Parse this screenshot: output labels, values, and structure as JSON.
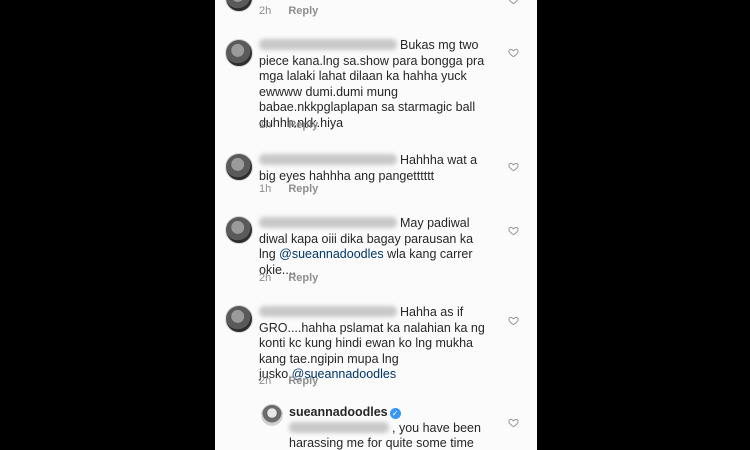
{
  "comments": [
    {
      "text": "",
      "time": "2h",
      "reply": "Reply"
    },
    {
      "text": "Bukas mg two piece kana.lng sa.show para bongga pra mga lalaki lahat dilaan ka hahha yuck ewwww dumi.dumi mung babae.nkkpglaplapan sa starmagic ball duhhh.nkk.hiya",
      "time": "1h",
      "reply": "Reply"
    },
    {
      "text": "Hahhha wat a big eyes hahhha ang pangetttttt",
      "time": "1h",
      "reply": "Reply"
    },
    {
      "text_before": "May padiwal diwal kapa oiii dika bagay parausan ka lng ",
      "mention": "@sueannadoodles",
      "text_after": " wla kang carrer okie....",
      "time": "2h",
      "reply": "Reply"
    },
    {
      "text": "Hahha as if GRO....hahha pslamat ka nalahian ka ng konti kc kung hindi ewan ko lng mukha kang tae.ngipin mupa lng jusko.",
      "mention": "@sueannadoodles",
      "time": "2h",
      "reply": "Reply"
    }
  ],
  "reply_comment": {
    "username": "sueannadoodles",
    "verified_mark": "✓",
    "text": ", you have been harassing me for quite some time now and I don't know what I"
  },
  "colors": {
    "mention": "#003569",
    "meta": "#8e8e8e",
    "verified": "#3897f0"
  }
}
